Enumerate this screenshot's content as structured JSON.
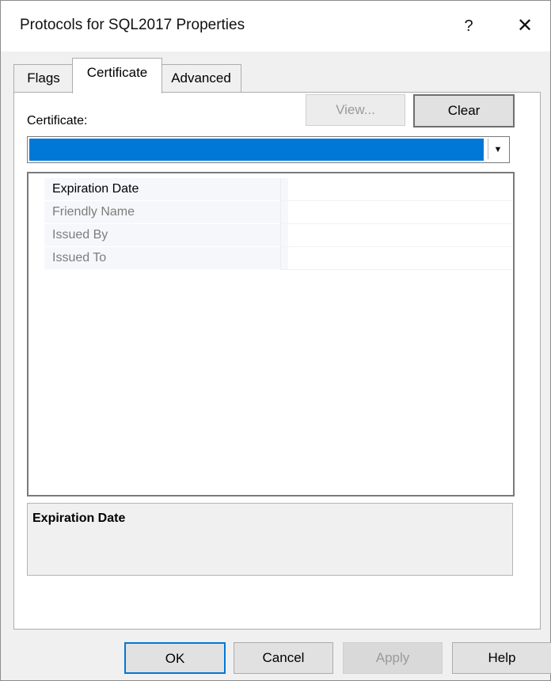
{
  "window": {
    "title": "Protocols for SQL2017 Properties",
    "help_glyph": "?",
    "close_glyph": "✕"
  },
  "tabs": [
    {
      "label": "Flags"
    },
    {
      "label": "Certificate",
      "selected": true
    },
    {
      "label": "Advanced"
    }
  ],
  "certificate": {
    "label": "Certificate:",
    "selected_value": "",
    "view_label": "View...",
    "clear_label": "Clear",
    "dropdown_arrow": "▼"
  },
  "properties": [
    {
      "name": "Expiration Date",
      "value": ""
    },
    {
      "name": "Friendly Name",
      "value": ""
    },
    {
      "name": "Issued By",
      "value": ""
    },
    {
      "name": "Issued To",
      "value": ""
    }
  ],
  "description": {
    "title": "Expiration Date"
  },
  "footer": {
    "ok_label": "OK",
    "cancel_label": "Cancel",
    "apply_label": "Apply",
    "help_label": "Help"
  },
  "colors": {
    "selection": "#0078d7",
    "dialog_bg": "#f0f0f0"
  }
}
